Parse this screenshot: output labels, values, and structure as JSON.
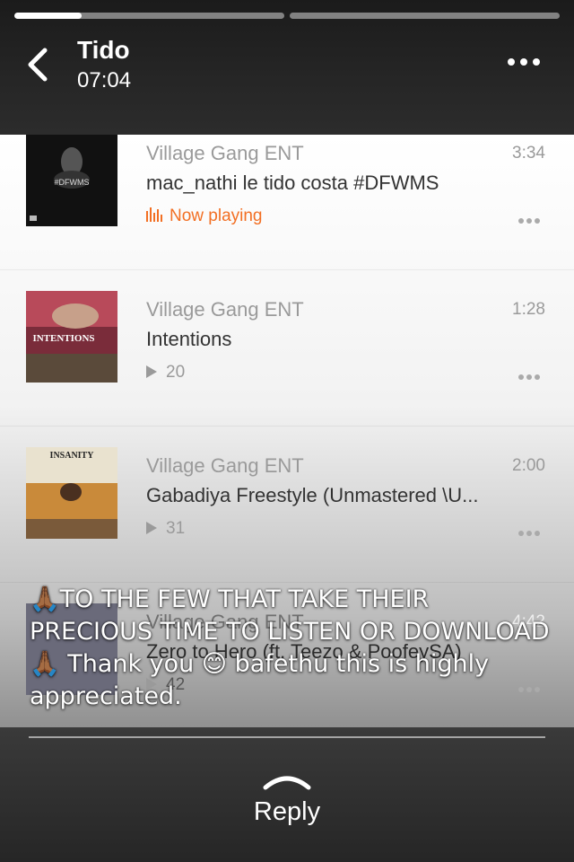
{
  "header": {
    "title": "Tido",
    "time": "07:04",
    "back_icon": "chevron-left-icon",
    "more_icon": "ellipsis-icon",
    "story_progress": [
      0.25,
      0.0
    ]
  },
  "tracks": [
    {
      "artist": "Village Gang ENT",
      "title": "mac_nathi le tido costa #DFWMS",
      "duration": "3:34",
      "status": "Now playing",
      "art_text": "#DFWMS",
      "art_color": "#111111"
    },
    {
      "artist": "Village Gang ENT",
      "title": "Intentions",
      "duration": "1:28",
      "plays": "20",
      "art_text": "INTENTIONS",
      "art_color": "#7a2c3a"
    },
    {
      "artist": "Village Gang ENT",
      "title": "Gabadiya Freestyle (Unmastered \\U...",
      "duration": "2:00",
      "plays": "31",
      "art_text": "INSANITY",
      "art_color": "#e9e2cf"
    },
    {
      "artist": "Village Gang ENT",
      "title": "Zero to Hero (ft. Teezo & PoofeySA)",
      "duration": "4:42",
      "plays": "42"
    }
  ],
  "caption": "🙏🏾TO THE FEW THAT TAKE THEIR PRECIOUS TIME TO LISTEN OR DOWNLOAD 🙏🏾 Thank you 😊 bafethu this is highly appreciated.",
  "reply": {
    "label": "Reply",
    "icon": "chevron-up-icon"
  },
  "colors": {
    "accent_orange": "#f26f23",
    "muted_text": "#9a9a9a"
  }
}
